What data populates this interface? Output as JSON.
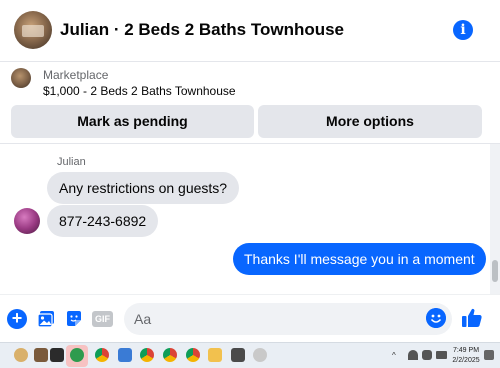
{
  "header": {
    "title": "Julian · 2 Beds 2 Baths Townhouse",
    "info_icon": "info-icon"
  },
  "marketplace": {
    "label": "Marketplace",
    "listing": "$1,000 - 2 Beds 2 Baths Townhouse",
    "buttons": {
      "pending": "Mark as pending",
      "more": "More options"
    }
  },
  "chat": {
    "sender": "Julian",
    "messages": [
      {
        "from": "Julian",
        "text": "Any restrictions on guests?"
      },
      {
        "from": "Julian",
        "text": "877-243-6892"
      },
      {
        "from": "me",
        "text": "Thanks I'll message you in a moment"
      }
    ]
  },
  "composer": {
    "placeholder": "Aa",
    "gif_label": "GIF",
    "plus_glyph": "+",
    "icons": [
      "plus-icon",
      "photo-icon",
      "sticker-icon",
      "gif-icon",
      "emoji-icon",
      "thumbs-up-icon"
    ]
  },
  "taskbar": {
    "time": "7:49 PM",
    "date": "2/2/2025",
    "tray_up": "^"
  },
  "colors": {
    "accent": "#0866ff",
    "bubble_in": "#e4e6eb",
    "button_bg": "#e4e6eb",
    "taskbar_bg": "#e9eef4"
  }
}
